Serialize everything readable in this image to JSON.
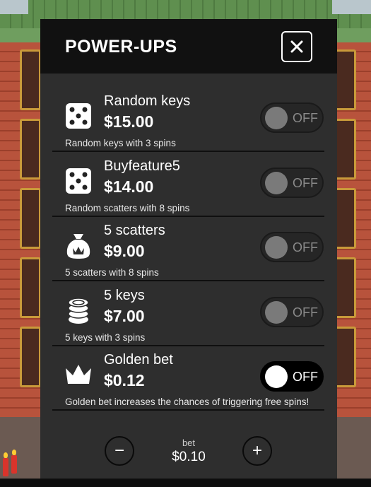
{
  "modal": {
    "title": "POWER-UPS",
    "close_icon": "close-icon"
  },
  "items": [
    {
      "icon": "dice-icon",
      "name": "Random keys",
      "price": "$15.00",
      "description": "Random keys with 3 spins",
      "toggle": "OFF"
    },
    {
      "icon": "dice-icon",
      "name": "Buyfeature5",
      "price": "$14.00",
      "description": "Random scatters with 8 spins",
      "toggle": "OFF"
    },
    {
      "icon": "money-bag-icon",
      "name": "5 scatters",
      "price": "$9.00",
      "description": "5 scatters with 8 spins",
      "toggle": "OFF"
    },
    {
      "icon": "coin-stack-icon",
      "name": "5 keys",
      "price": "$7.00",
      "description": "5 keys with 3 spins",
      "toggle": "OFF"
    },
    {
      "icon": "crown-icon",
      "name": "Golden bet",
      "price": "$0.12",
      "description": "Golden bet increases the chances of triggering free spins!",
      "toggle": "OFF"
    }
  ],
  "bet": {
    "label": "bet",
    "value": "$0.10",
    "decrease": "−",
    "increase": "+"
  }
}
